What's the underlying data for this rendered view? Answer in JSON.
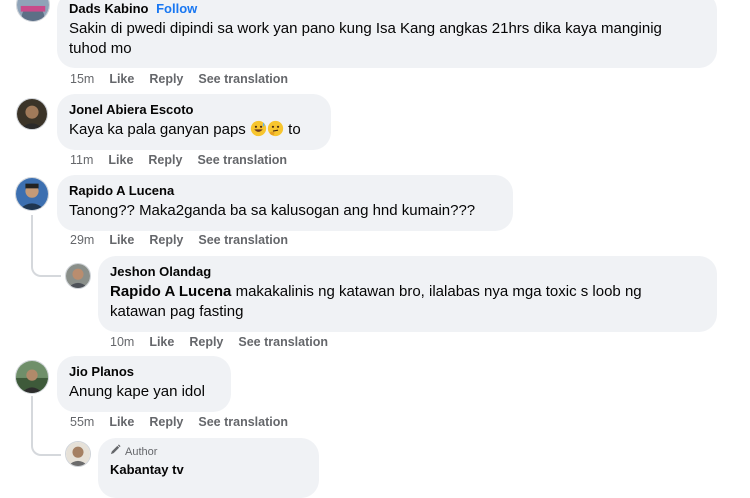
{
  "comments": [
    {
      "author": "Dads Kabino",
      "follow": "Follow",
      "text": "Sakin di pwedi dipindi sa work yan pano kung Isa Kang angkas 21hrs dika kaya manginig tuhod mo",
      "time": "15m",
      "like": "Like",
      "reply": "Reply",
      "translation": "See translation"
    },
    {
      "author": "Jonel Abiera Escoto",
      "text_before": "Kaya ka pala ganyan paps",
      "text_after": "to",
      "emojis": [
        "grinning-sweat-face",
        "thinking-face"
      ],
      "time": "11m",
      "like": "Like",
      "reply": "Reply",
      "translation": "See translation"
    },
    {
      "author": "Rapido A Lucena",
      "text": "Tanong?? Maka2ganda ba sa kalusogan ang hnd kumain???",
      "time": "29m",
      "like": "Like",
      "reply": "Reply",
      "translation": "See translation"
    },
    {
      "author": "Jeshon Olandag",
      "mention": "Rapido A Lucena",
      "text": " makakalinis ng katawan bro, ilalabas nya mga toxic s loob ng katawan pag fasting",
      "time": "10m",
      "like": "Like",
      "reply": "Reply",
      "translation": "See translation"
    },
    {
      "author": "Jio Planos",
      "text": "Anung kape yan idol",
      "time": "55m",
      "like": "Like",
      "reply": "Reply",
      "translation": "See translation"
    },
    {
      "badge": "Author",
      "author": "Kabantay tv"
    }
  ]
}
